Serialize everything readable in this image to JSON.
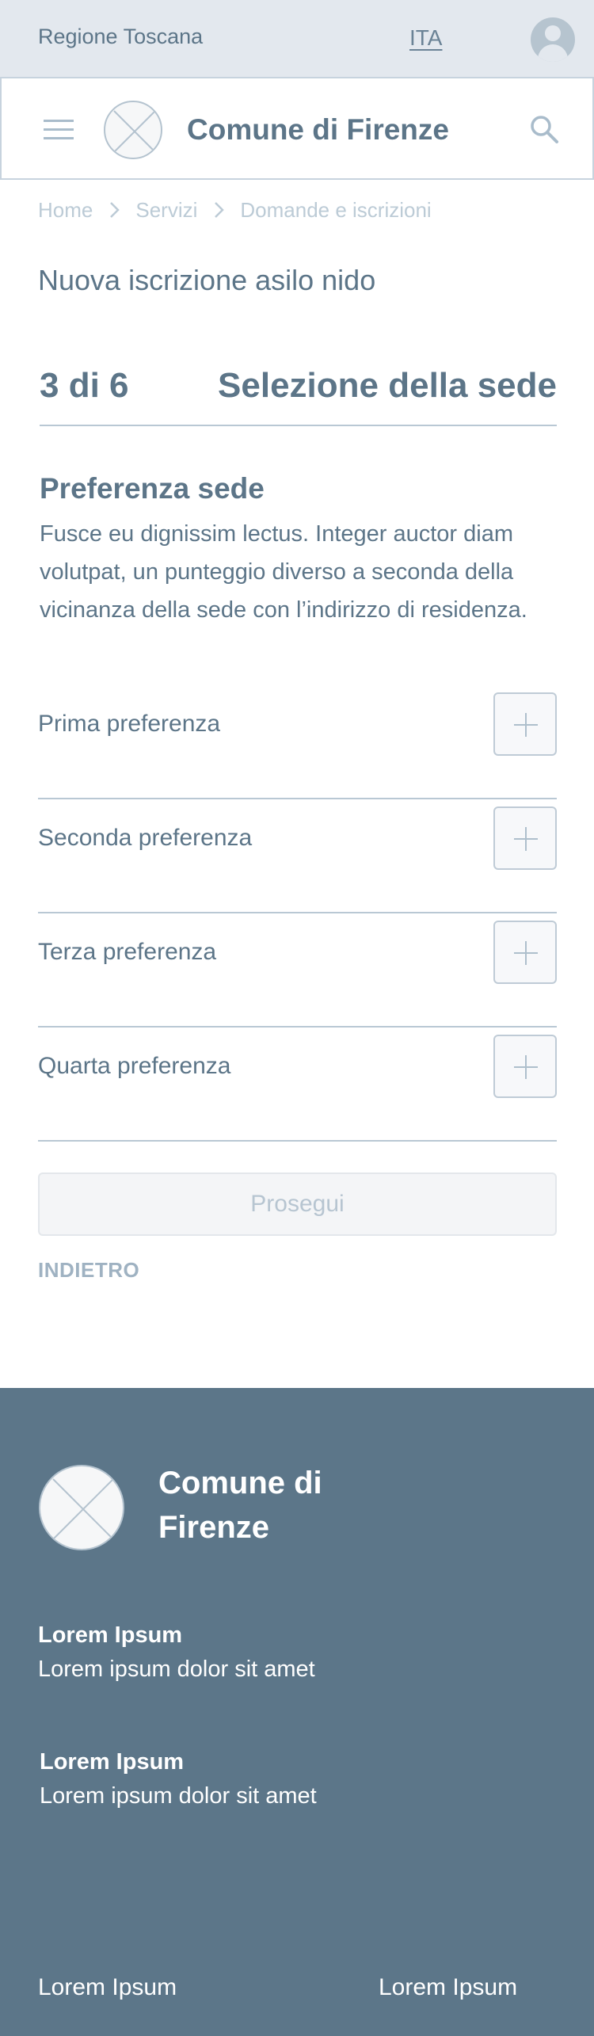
{
  "topbar": {
    "region": "Regione Toscana",
    "language": "ITA"
  },
  "header": {
    "site_title": "Comune di Firenze"
  },
  "breadcrumb": [
    "Home",
    "Servizi",
    "Domande e iscrizioni"
  ],
  "page_title": "Nuova iscrizione asilo nido",
  "stepper": {
    "count": "3 di 6",
    "name": "Selezione della sede"
  },
  "section": {
    "title": "Preferenza sede",
    "description": "Fusce eu dignissim lectus. Integer auctor diam volutpat, un punteggio diverso a seconda della vicinanza della sede con l’indirizzo di residenza."
  },
  "preferences": [
    {
      "label": "Prima preferenza"
    },
    {
      "label": "Seconda preferenza"
    },
    {
      "label": "Terza preferenza"
    },
    {
      "label": "Quarta preferenza"
    }
  ],
  "actions": {
    "continue_label": "Prosegui",
    "back_label": "INDIETRO"
  },
  "footer": {
    "title": "Comune di Firenze",
    "blocks": [
      {
        "heading": "Lorem Ipsum",
        "text": "Lorem ipsum dolor sit amet"
      },
      {
        "heading": "Lorem Ipsum",
        "text": "Lorem ipsum dolor sit amet"
      }
    ],
    "links": [
      "Lorem Ipsum",
      "Lorem Ipsum"
    ]
  },
  "icons": {
    "menu": "hamburger-menu-icon",
    "search": "search-icon",
    "user": "user-icon",
    "logo": "placeholder-logo",
    "separator": "chevron-right-icon",
    "add": "plus-icon"
  },
  "colors": {
    "primary_text": "#5c7588",
    "topbar_bg": "#e3e8ee",
    "footer_bg": "#5c7689",
    "divider": "#b9c8d4",
    "disabled_button_bg": "#f4f5f7"
  }
}
